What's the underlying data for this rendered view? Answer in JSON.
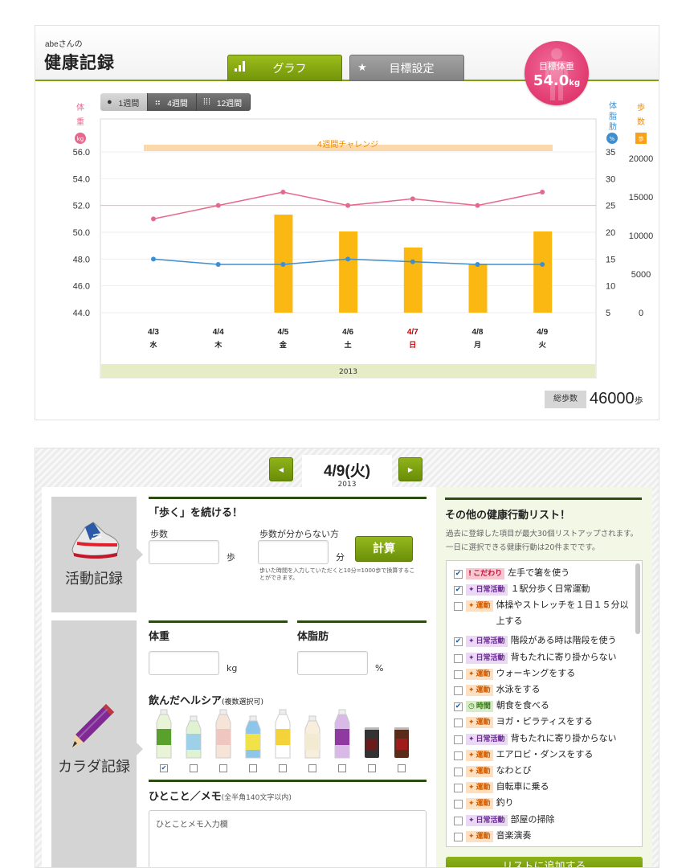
{
  "header": {
    "user": "abeさんの",
    "title": "健康記録"
  },
  "tabs": [
    {
      "label": "グラフ",
      "icon": "bar-signal-icon"
    },
    {
      "label": "目標設定",
      "icon": "star-icon"
    }
  ],
  "goal": {
    "label": "目標体重",
    "value": "54.0",
    "unit": "kg"
  },
  "periods": [
    {
      "label": "1週間"
    },
    {
      "label": "4週間"
    },
    {
      "label": "12週間"
    }
  ],
  "axis_labels": {
    "weight": "体重",
    "weight_unit": "kg",
    "fat": "体脂肪",
    "fat_unit": "%",
    "steps": "歩数",
    "steps_unit": "歩"
  },
  "chart_data": {
    "type": "bar",
    "title": "",
    "challenge_label": "4週間チャレンジ",
    "year_label": "2013",
    "x": [
      "4/3",
      "4/4",
      "4/5",
      "4/6",
      "4/7",
      "4/8",
      "4/9"
    ],
    "weekdays": [
      "水",
      "木",
      "金",
      "土",
      "日",
      "月",
      "火"
    ],
    "holiday_color": "#cc0000",
    "holiday_index": 4,
    "y_left_ticks": [
      "56.0",
      "54.0",
      "52.0",
      "50.0",
      "48.0",
      "46.0",
      "44.0"
    ],
    "y_left_range": [
      44,
      56
    ],
    "y_fat_ticks": [
      "35",
      "30",
      "25",
      "20",
      "15",
      "10",
      "5"
    ],
    "y_fat_range": [
      5,
      35
    ],
    "y_steps_ticks": [
      "20000",
      "15000",
      "10000",
      "5000",
      "0"
    ],
    "y_steps_range": [
      0,
      20000
    ],
    "goal_line_value": 52.0,
    "series": [
      {
        "name": "体重",
        "axis": "weight",
        "color": "#e8678d",
        "type": "line",
        "values": [
          51.0,
          52.0,
          53.0,
          52.0,
          52.5,
          52.0,
          53.0
        ]
      },
      {
        "name": "体脂肪",
        "axis": "fat",
        "color": "#3d8fd1",
        "type": "line",
        "values": [
          15,
          14,
          14,
          15,
          14.5,
          14,
          14
        ]
      },
      {
        "name": "歩数",
        "axis": "steps",
        "color": "#fbb813",
        "type": "bar",
        "values": [
          0,
          0,
          12200,
          0,
          0,
          0,
          0
        ],
        "values_full": [
          0,
          0,
          12200,
          10100,
          8100,
          6100,
          10100
        ]
      }
    ]
  },
  "total_steps": {
    "label": "総歩数",
    "value": "46000",
    "unit": "歩"
  },
  "date_nav": {
    "date": "4/9(火)",
    "year": "2013",
    "prev": "◀",
    "next": "▶"
  },
  "activity": {
    "side_label": "活動記録",
    "title": "「歩く」を続ける！",
    "steps_label": "歩数",
    "steps_unit": "歩",
    "unknown_label": "歩数が分からない方",
    "minutes_unit": "分",
    "calc_button": "計算",
    "note": "歩いた時間を入力していただくと10分=1000歩で換算することができます。"
  },
  "body": {
    "side_label": "カラダ記録",
    "weight_title": "体重",
    "weight_unit": "kg",
    "fat_title": "体脂肪",
    "fat_unit": "%",
    "drinks_title": "飲んだヘルシア",
    "drinks_note": "(複数選択可)",
    "drinks_checked": [
      true,
      false,
      false,
      false,
      false,
      false,
      false,
      false,
      false
    ],
    "memo_title": "ひとこと／メモ",
    "memo_note": "(全半角140文字以内)",
    "memo_placeholder": "ひとことメモ入力欄"
  },
  "right_panel": {
    "title": "その他の健康行動リスト！",
    "description": "過去に登録した項目が最大30個リストアップされます。一日に選択できる健康行動は20件までです。",
    "add_button": "リストに追加する",
    "items": [
      {
        "checked": true,
        "tag": "こだわり",
        "tag_type": "kd",
        "label": "左手で箸を使う"
      },
      {
        "checked": true,
        "tag": "日常活動",
        "tag_type": "nj",
        "label": "１駅分歩く日常運動"
      },
      {
        "checked": false,
        "tag": "運動",
        "tag_type": "ud",
        "label": "体操やストレッチを１日１５分以上する"
      },
      {
        "checked": true,
        "tag": "日常活動",
        "tag_type": "nj",
        "label": "階段がある時は階段を使う"
      },
      {
        "checked": false,
        "tag": "日常活動",
        "tag_type": "nj",
        "label": "背もたれに寄り掛からない"
      },
      {
        "checked": false,
        "tag": "運動",
        "tag_type": "ud",
        "label": "ウォーキングをする"
      },
      {
        "checked": false,
        "tag": "運動",
        "tag_type": "ud",
        "label": "水泳をする"
      },
      {
        "checked": true,
        "tag": "時間",
        "tag_type": "jk",
        "label": "朝食を食べる"
      },
      {
        "checked": false,
        "tag": "運動",
        "tag_type": "ud",
        "label": "ヨガ・ピラティスをする"
      },
      {
        "checked": false,
        "tag": "日常活動",
        "tag_type": "nj",
        "label": "背もたれに寄り掛からない"
      },
      {
        "checked": false,
        "tag": "運動",
        "tag_type": "ud",
        "label": "エアロビ・ダンスをする"
      },
      {
        "checked": false,
        "tag": "運動",
        "tag_type": "ud",
        "label": "なわとび"
      },
      {
        "checked": false,
        "tag": "運動",
        "tag_type": "ud",
        "label": "自転車に乗る"
      },
      {
        "checked": false,
        "tag": "運動",
        "tag_type": "ud",
        "label": "釣り"
      },
      {
        "checked": false,
        "tag": "日常活動",
        "tag_type": "nj",
        "label": "部屋の掃除"
      },
      {
        "checked": false,
        "tag": "運動",
        "tag_type": "ud",
        "label": "音楽演奏"
      }
    ]
  }
}
